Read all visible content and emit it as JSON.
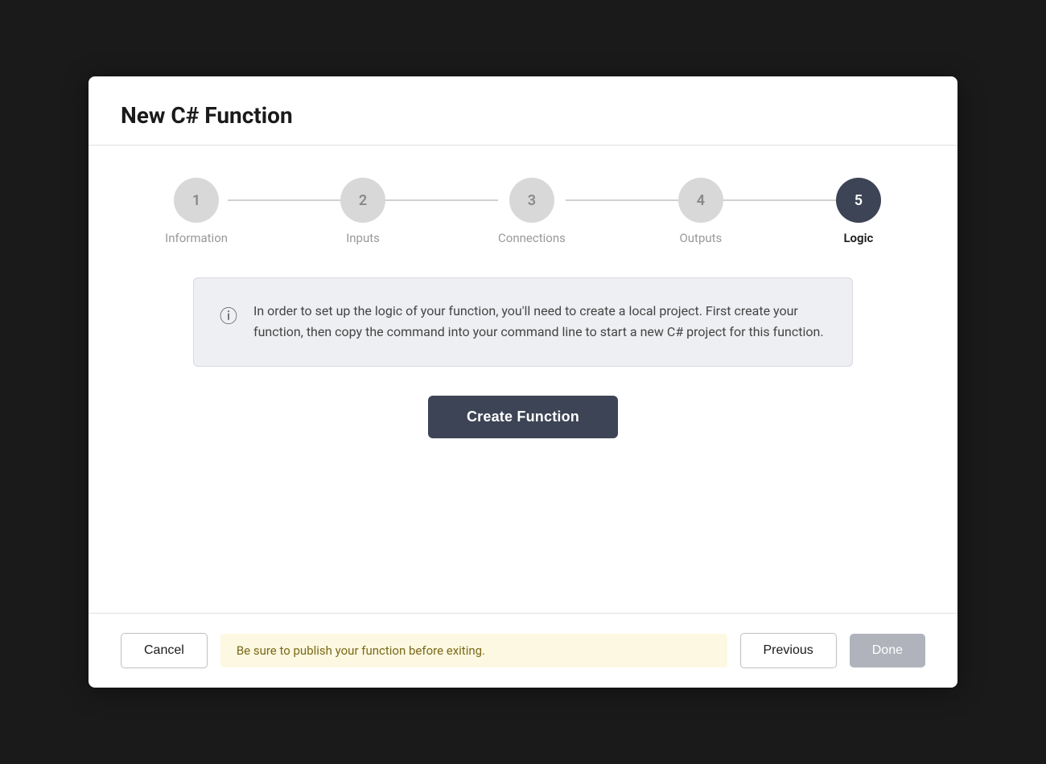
{
  "dialog": {
    "title": "New C# Function"
  },
  "stepper": {
    "steps": [
      {
        "number": "1",
        "label": "Information",
        "active": false
      },
      {
        "number": "2",
        "label": "Inputs",
        "active": false
      },
      {
        "number": "3",
        "label": "Connections",
        "active": false
      },
      {
        "number": "4",
        "label": "Outputs",
        "active": false
      },
      {
        "number": "5",
        "label": "Logic",
        "active": true
      }
    ]
  },
  "info_box": {
    "text": "In order to set up the logic of your function, you'll need to create a local project. First create your function, then copy the command into your command line to start a new C# project for this function."
  },
  "buttons": {
    "create_function": "Create Function",
    "cancel": "Cancel",
    "warning": "Be sure to publish your function before exiting.",
    "previous": "Previous",
    "done": "Done"
  }
}
